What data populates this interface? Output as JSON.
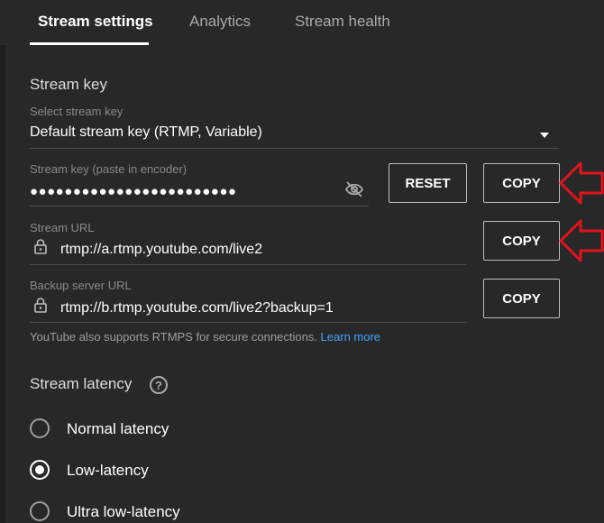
{
  "tabs": [
    {
      "label": "Stream settings",
      "active": true
    },
    {
      "label": "Analytics",
      "active": false
    },
    {
      "label": "Stream health",
      "active": false
    }
  ],
  "stream_key": {
    "section_title": "Stream key",
    "select_label": "Select stream key",
    "select_value": "Default stream key (RTMP, Variable)",
    "key_label": "Stream key (paste in encoder)",
    "key_value": "●●●●●●●●●●●●●●●●●●●●●●●●",
    "reset_label": "RESET",
    "copy_label": "COPY"
  },
  "stream_url": {
    "label": "Stream URL",
    "value": "rtmp://a.rtmp.youtube.com/live2",
    "copy_label": "COPY"
  },
  "backup_url": {
    "label": "Backup server URL",
    "value": "rtmp://b.rtmp.youtube.com/live2?backup=1",
    "copy_label": "COPY"
  },
  "rtmps_note": {
    "text": "YouTube also supports RTMPS for secure connections.",
    "link": "Learn more"
  },
  "latency": {
    "title": "Stream latency",
    "help": "?",
    "options": [
      {
        "label": "Normal latency",
        "selected": false
      },
      {
        "label": "Low-latency",
        "selected": true
      },
      {
        "label": "Ultra low-latency",
        "selected": false
      }
    ]
  },
  "colors": {
    "background": "#282828",
    "link": "#3ea6ff",
    "annotation_arrow": "#e0141e"
  }
}
